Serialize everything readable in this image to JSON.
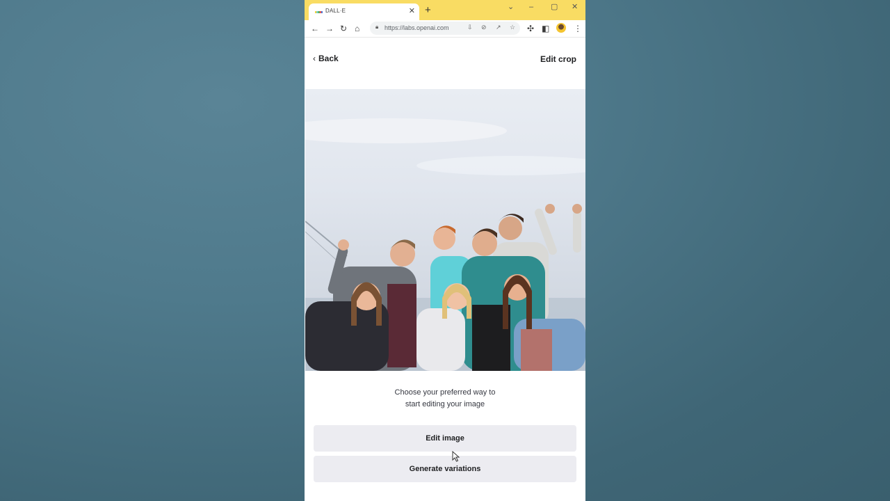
{
  "browser": {
    "tab_title": "DALL·E",
    "tab_close": "✕",
    "new_tab": "+",
    "url": "https://labs.openai.com"
  },
  "page": {
    "back_label": "Back",
    "edit_crop_label": "Edit crop",
    "prompt_line1": "Choose your preferred way to",
    "prompt_line2": "start editing your image",
    "edit_image_label": "Edit image",
    "generate_variations_label": "Generate variations"
  },
  "colors": {
    "tabstrip": "#f9dc63",
    "button_bg": "#ececf1",
    "text": "#202123"
  }
}
